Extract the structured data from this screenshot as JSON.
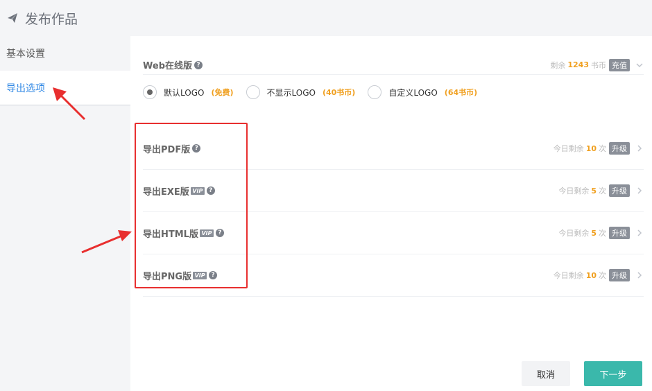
{
  "header": {
    "title": "发布作品",
    "icon": "paper-plane-icon"
  },
  "sidebar": {
    "items": [
      {
        "label": "基本设置"
      },
      {
        "label": "导出选项"
      }
    ]
  },
  "web": {
    "label": "Web在线版",
    "remaining_prefix": "剩余",
    "remaining_count": "1243",
    "remaining_unit": "书币",
    "recharge": "充值",
    "options": [
      {
        "label": "默认LOGO",
        "price": "(免费)"
      },
      {
        "label": "不显示LOGO",
        "price": "(40书币)"
      },
      {
        "label": "自定义LOGO",
        "price": "(64书币)"
      }
    ]
  },
  "exports": [
    {
      "label": "导出PDF版",
      "vip": false,
      "prefix": "今日剩余",
      "count": "10",
      "unit": "次",
      "upgrade": "升级"
    },
    {
      "label": "导出EXE版",
      "vip": true,
      "vip_text": "VIP",
      "prefix": "今日剩余",
      "count": "5",
      "unit": "次",
      "upgrade": "升级"
    },
    {
      "label": "导出HTML版",
      "vip": true,
      "vip_text": "VIP",
      "prefix": "今日剩余",
      "count": "5",
      "unit": "次",
      "upgrade": "升级"
    },
    {
      "label": "导出PNG版",
      "vip": true,
      "vip_text": "VIP",
      "prefix": "今日剩余",
      "count": "10",
      "unit": "次",
      "upgrade": "升级"
    }
  ],
  "buttons": {
    "cancel": "取消",
    "next": "下一步"
  },
  "colors": {
    "accent": "#3ab8ab",
    "highlight": "#f0a020",
    "annotation": "#e82f2f",
    "link": "#2b85e4"
  }
}
